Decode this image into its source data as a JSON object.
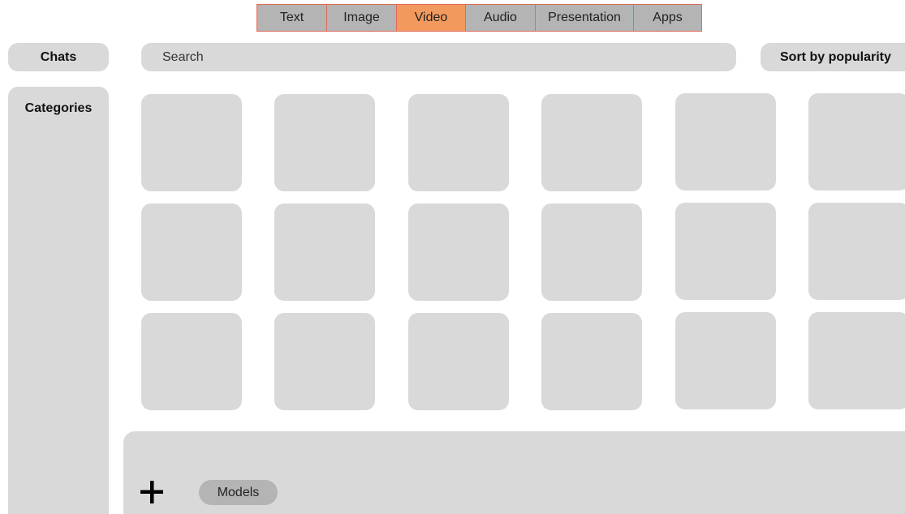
{
  "tabs": [
    {
      "label": "Text",
      "active": false
    },
    {
      "label": "Image",
      "active": false
    },
    {
      "label": "Video",
      "active": true
    },
    {
      "label": "Audio",
      "active": false
    },
    {
      "label": "Presentation",
      "active": false
    },
    {
      "label": "Apps",
      "active": false
    }
  ],
  "header": {
    "chats_label": "Chats",
    "search_placeholder": "Search",
    "sort_label": "Sort by popularity"
  },
  "sidebar": {
    "title": "Categories"
  },
  "grid": {
    "rows": 3,
    "columns": 6
  },
  "footer": {
    "add_icon": "plus-icon",
    "models_label": "Models"
  },
  "colors": {
    "tab_active": "#f29a5e",
    "tab_inactive": "#b4b4b4",
    "tab_border": "#e06a5a",
    "panel": "#d9d9d9",
    "chip": "#b4b4b4"
  }
}
